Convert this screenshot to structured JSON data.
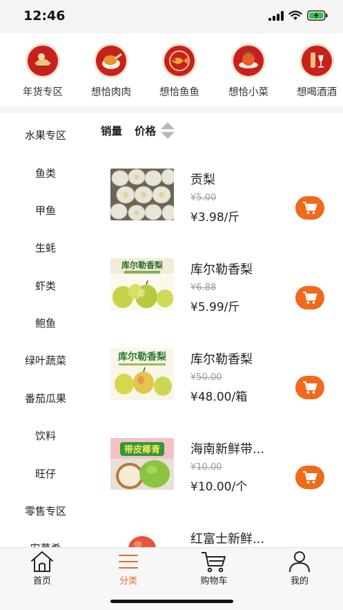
{
  "status_bar": {
    "time": "12:46",
    "icons": [
      "signal-icon",
      "wifi-icon",
      "battery-charging-icon"
    ]
  },
  "categories": [
    {
      "label": "年货专区",
      "icon": "new-year-goods-icon"
    },
    {
      "label": "想恰肉肉",
      "icon": "roast-chicken-icon"
    },
    {
      "label": "想恰鱼鱼",
      "icon": "fish-icon"
    },
    {
      "label": "想恰小菜",
      "icon": "side-dish-icon"
    },
    {
      "label": "想喝酒酒",
      "icon": "wine-icon"
    }
  ],
  "sidebar": {
    "items": [
      {
        "label": "水果专区"
      },
      {
        "label": "鱼类"
      },
      {
        "label": "甲鱼"
      },
      {
        "label": "生蚝"
      },
      {
        "label": "虾类"
      },
      {
        "label": "鲍鱼"
      },
      {
        "label": "绿叶蔬菜"
      },
      {
        "label": "番茄瓜果"
      },
      {
        "label": "饮料"
      },
      {
        "label": "旺仔"
      },
      {
        "label": "零售专区"
      },
      {
        "label": "安慕希"
      }
    ]
  },
  "sort": {
    "sales_label": "销量",
    "price_label": "价格"
  },
  "products": [
    {
      "name": "贡梨",
      "old_price": "¥5.00",
      "price": "¥3.98/斤",
      "image": "pears-in-foam-net"
    },
    {
      "name": "库尔勒香梨",
      "old_price": "¥6.88",
      "price": "¥5.99/斤",
      "image": "korla-pear-box",
      "image_text": "库尔勒香梨"
    },
    {
      "name": "库尔勒香梨",
      "old_price": "¥50.00",
      "price": "¥48.00/箱",
      "image": "korla-pear-box",
      "image_text": "库尔勒香梨"
    },
    {
      "name": "海南新鲜带...",
      "old_price": "¥10.00",
      "price": "¥10.00/个",
      "image": "coconut",
      "image_text": "带皮椰青"
    },
    {
      "name": "红富士新鲜...",
      "old_price": "",
      "price": "",
      "image": "red-apple"
    }
  ],
  "tab_bar": {
    "tabs": [
      {
        "label": "首页",
        "icon": "home-icon"
      },
      {
        "label": "分类",
        "icon": "menu-icon"
      },
      {
        "label": "购物车",
        "icon": "cart-icon"
      },
      {
        "label": "我的",
        "icon": "user-icon"
      }
    ],
    "active_index": 1
  },
  "colors": {
    "accent": "#f06a1c",
    "active_tab": "#e8692a",
    "category_icon_bg": "#c8201e",
    "page_bg": "#f4f4f4"
  }
}
